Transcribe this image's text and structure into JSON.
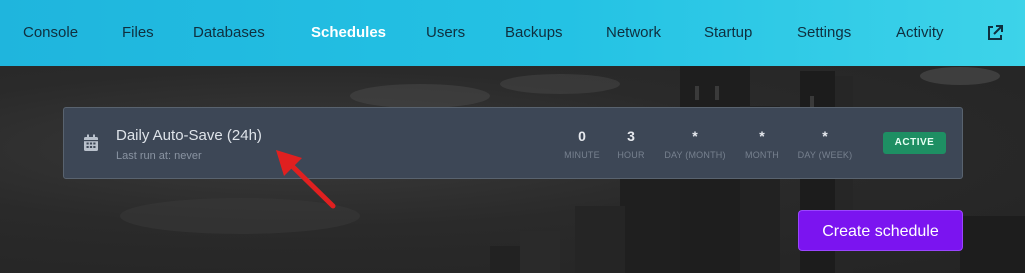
{
  "nav": {
    "items": [
      {
        "label": "Console"
      },
      {
        "label": "Files"
      },
      {
        "label": "Databases"
      },
      {
        "label": "Schedules",
        "active": true
      },
      {
        "label": "Users"
      },
      {
        "label": "Backups"
      },
      {
        "label": "Network"
      },
      {
        "label": "Startup"
      },
      {
        "label": "Settings"
      },
      {
        "label": "Activity"
      }
    ],
    "external_link_icon": "external-link-icon"
  },
  "schedule": {
    "icon": "calendar-icon",
    "name": "Daily Auto-Save (24h)",
    "last_run": "Last run at: never",
    "cron": [
      {
        "value": "0",
        "label": "MINUTE"
      },
      {
        "value": "3",
        "label": "HOUR"
      },
      {
        "value": "*",
        "label": "DAY (MONTH)"
      },
      {
        "value": "*",
        "label": "MONTH"
      },
      {
        "value": "*",
        "label": "DAY (WEEK)"
      }
    ],
    "status": "ACTIVE"
  },
  "actions": {
    "create_label": "Create schedule"
  },
  "colors": {
    "nav_gradient_start": "#1fb5dd",
    "nav_gradient_end": "#3dd3e9",
    "card_bg": "#3d4756",
    "status_green": "#1e8f63",
    "primary_purple": "#7b14f0",
    "annotation_red": "#e02020"
  }
}
